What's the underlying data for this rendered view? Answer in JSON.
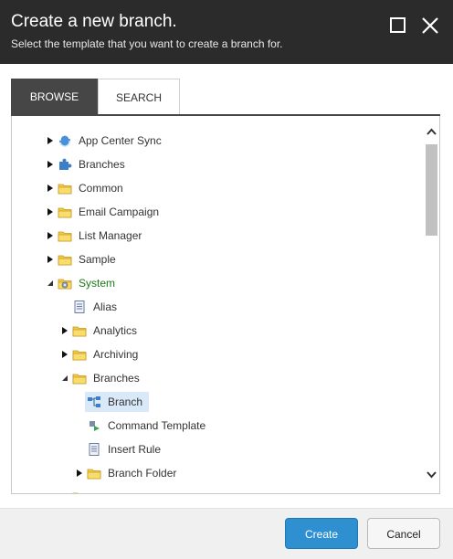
{
  "dialog": {
    "title": "Create a new branch.",
    "subtitle": "Select the template that you want to create a branch for."
  },
  "tabs": [
    {
      "label": "BROWSE",
      "active": true
    },
    {
      "label": "SEARCH",
      "active": false
    }
  ],
  "tree": {
    "items": [
      {
        "label": "App Center Sync",
        "icon": "sync-globe-icon",
        "expander": "collapsed"
      },
      {
        "label": "Branches",
        "icon": "puzzle-icon",
        "expander": "collapsed"
      },
      {
        "label": "Common",
        "icon": "folder-icon",
        "expander": "collapsed"
      },
      {
        "label": "Email Campaign",
        "icon": "folder-icon",
        "expander": "collapsed"
      },
      {
        "label": "List Manager",
        "icon": "folder-icon",
        "expander": "collapsed"
      },
      {
        "label": "Sample",
        "icon": "folder-icon",
        "expander": "collapsed"
      },
      {
        "label": "System",
        "icon": "folder-gear-icon",
        "expander": "expanded"
      },
      {
        "label": "Alias",
        "icon": "document-icon",
        "expander": "none"
      },
      {
        "label": "Analytics",
        "icon": "folder-icon",
        "expander": "collapsed"
      },
      {
        "label": "Archiving",
        "icon": "folder-icon",
        "expander": "collapsed"
      },
      {
        "label": "Branches",
        "icon": "folder-icon",
        "expander": "expanded"
      },
      {
        "label": "Branch",
        "icon": "branch-icon",
        "expander": "none",
        "selected": true
      },
      {
        "label": "Command Template",
        "icon": "command-icon",
        "expander": "none"
      },
      {
        "label": "Insert Rule",
        "icon": "document-icon",
        "expander": "none"
      },
      {
        "label": "Branch Folder",
        "icon": "folder-icon",
        "expander": "collapsed"
      }
    ]
  },
  "buttons": {
    "create": "Create",
    "cancel": "Cancel"
  },
  "colors": {
    "header_bg": "#2b2b2b",
    "tab_active_bg": "#464646",
    "primary_button": "#2e8fd1",
    "selected_row": "#d9e9f7",
    "system_label": "#1a7a1a"
  }
}
